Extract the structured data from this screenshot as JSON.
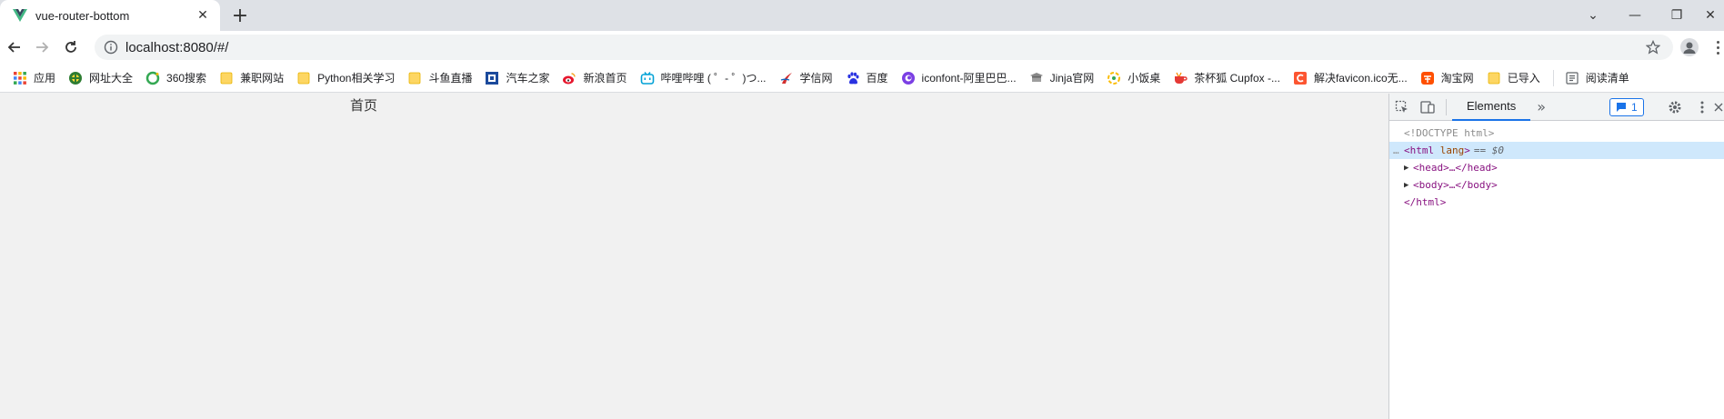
{
  "browser": {
    "tab": {
      "title": "vue-router-bottom",
      "close": "✕"
    },
    "new_tab": "+",
    "window_controls": {
      "down": "⌄",
      "min": "—",
      "restore": "❐",
      "close": "✕"
    },
    "url": "localhost:8080/#/",
    "bookmarks": [
      {
        "label": "应用",
        "icon": "apps-grid-icon"
      },
      {
        "label": "网址大全",
        "icon": "hao-icon"
      },
      {
        "label": "360搜索",
        "icon": "360-icon"
      },
      {
        "label": "兼职网站",
        "icon": "folder-icon"
      },
      {
        "label": "Python相关学习",
        "icon": "folder-icon"
      },
      {
        "label": "斗鱼直播",
        "icon": "folder-icon"
      },
      {
        "label": "汽车之家",
        "icon": "autohome-icon"
      },
      {
        "label": "新浪首页",
        "icon": "weibo-icon"
      },
      {
        "label": "哔哩哔哩 ( ゜- ゜)つ...",
        "icon": "bilibili-icon"
      },
      {
        "label": "学信网",
        "icon": "xuexin-icon"
      },
      {
        "label": "百度",
        "icon": "baidu-paw-icon"
      },
      {
        "label": "iconfont-阿里巴巴...",
        "icon": "iconfont-icon"
      },
      {
        "label": "Jinja官网",
        "icon": "jinja-icon"
      },
      {
        "label": "小饭桌",
        "icon": "xiaofanzhuo-icon"
      },
      {
        "label": "茶杯狐 Cupfox -...",
        "icon": "cupfox-icon"
      },
      {
        "label": "解决favicon.ico无...",
        "icon": "csdn-icon"
      },
      {
        "label": "淘宝网",
        "icon": "taobao-icon"
      },
      {
        "label": "已导入",
        "icon": "folder-icon"
      }
    ],
    "reading_list": "阅读清单"
  },
  "page": {
    "heading": "首页"
  },
  "devtools": {
    "tab_label": "Elements",
    "more": "»",
    "issues_count": "1",
    "tree": {
      "doctype": "<!DOCTYPE html>",
      "html_open": "<html",
      "html_attr": "lang",
      "html_close_bracket": ">",
      "selected_marker": "== $0",
      "head": "<head>…</head>",
      "body": "<body>…</body>",
      "html_end": "</html>"
    }
  },
  "colors": {
    "accent": "#1a73e8",
    "tag": "#881280",
    "selected": "#cfe8fc"
  }
}
